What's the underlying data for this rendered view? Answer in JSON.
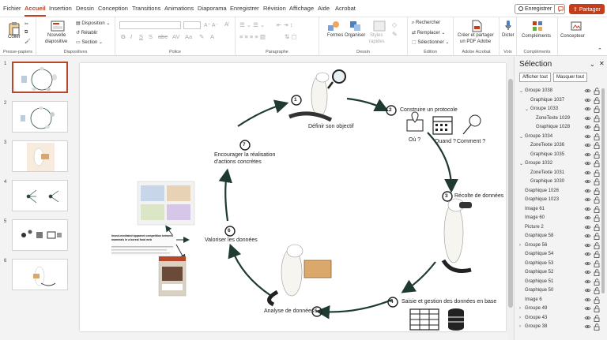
{
  "menu": {
    "fichier": "Fichier",
    "accueil": "Accueil",
    "insertion": "Insertion",
    "dessin": "Dessin",
    "conception": "Conception",
    "transitions": "Transitions",
    "animations": "Animations",
    "diaporama": "Diaporama",
    "enregistrer": "Enregistrer",
    "revision": "Révision",
    "affichage": "Affichage",
    "aide": "Aide",
    "acrobat": "Acrobat"
  },
  "topbar": {
    "record": "Enregistrer",
    "share": "Partager"
  },
  "ribbon": {
    "presse_papiers": "Presse-papiers",
    "coller": "Coller",
    "nouvelle": "Nouvelle",
    "diapositive": "diapositive",
    "disposition": "Disposition",
    "retablir": "Rétablir",
    "section": "Section",
    "diapositives": "Diapositives",
    "police": "Police",
    "paragraphe": "Paragraphe",
    "formes": "Formes",
    "organiser": "Organiser",
    "styles": "Styles",
    "rapides": "rapides",
    "dessin": "Dessin",
    "rechercher": "Rechercher",
    "remplacer": "Remplacer",
    "selectionner": "Sélectionner",
    "edition": "Édition",
    "creer1": "Créer et partager",
    "creer2": "un PDF Adobe",
    "adobe": "Adobe Acrobat",
    "dicter": "Dicter",
    "voix": "Voix",
    "complements": "Compléments",
    "complements_group": "Compléments",
    "concepteur": "Concepteur"
  },
  "thumbs": [
    "1",
    "2",
    "3",
    "4",
    "5",
    "6"
  ],
  "slide": {
    "s1_num": "1",
    "s1": "Définir son objectif",
    "s2_num": "2",
    "s2": "Construire un protocole",
    "q_ou": "Où ?",
    "q_quand": "Quand ?",
    "q_comment": "Comment ?",
    "s3_num": "3",
    "s3": "Récolte de données",
    "s4_num": "4",
    "s4": "Saisie et gestion des données en base",
    "s5_num": "5",
    "s5": "Analyse de données",
    "s6_num": "6",
    "s6": "Valoriser les données",
    "s7_num": "7",
    "s7a": "Encourager la réalisation",
    "s7b": "d'actions concrètes",
    "paper_title": "Insect-mediated apparent competition between mammals in a boreal food web"
  },
  "pane": {
    "title": "Sélection",
    "show_all": "Afficher tout",
    "hide_all": "Masquer tout",
    "items": [
      {
        "label": "Groupe 1038",
        "chev": "⌄"
      },
      {
        "label": "Graphique 1037",
        "chev": ""
      },
      {
        "label": "Groupe 1033",
        "chev": "⌄"
      },
      {
        "label": "ZoneTexte 1029",
        "chev": ""
      },
      {
        "label": "Graphique 1028",
        "chev": ""
      },
      {
        "label": "Groupe 1034",
        "chev": "⌄"
      },
      {
        "label": "ZoneTexte 1036",
        "chev": ""
      },
      {
        "label": "Graphique 1035",
        "chev": ""
      },
      {
        "label": "Groupe 1032",
        "chev": "⌄"
      },
      {
        "label": "ZoneTexte 1031",
        "chev": ""
      },
      {
        "label": "Graphique 1030",
        "chev": ""
      },
      {
        "label": "Graphique 1026",
        "chev": ""
      },
      {
        "label": "Graphique 1023",
        "chev": ""
      },
      {
        "label": "Image 61",
        "chev": ""
      },
      {
        "label": "Image 60",
        "chev": ""
      },
      {
        "label": "Picture 2",
        "chev": ""
      },
      {
        "label": "Graphique 58",
        "chev": ""
      },
      {
        "label": "Groupe 56",
        "chev": "›"
      },
      {
        "label": "Graphique 54",
        "chev": ""
      },
      {
        "label": "Graphique 53",
        "chev": ""
      },
      {
        "label": "Graphique 52",
        "chev": ""
      },
      {
        "label": "Graphique 51",
        "chev": ""
      },
      {
        "label": "Graphique 50",
        "chev": ""
      },
      {
        "label": "Image 6",
        "chev": ""
      },
      {
        "label": "Groupe 49",
        "chev": "›"
      },
      {
        "label": "Groupe 43",
        "chev": "›"
      },
      {
        "label": "Groupe 38",
        "chev": "›"
      }
    ]
  },
  "colors": {
    "accent": "#b7472a",
    "arrow": "#1f3b2f"
  }
}
